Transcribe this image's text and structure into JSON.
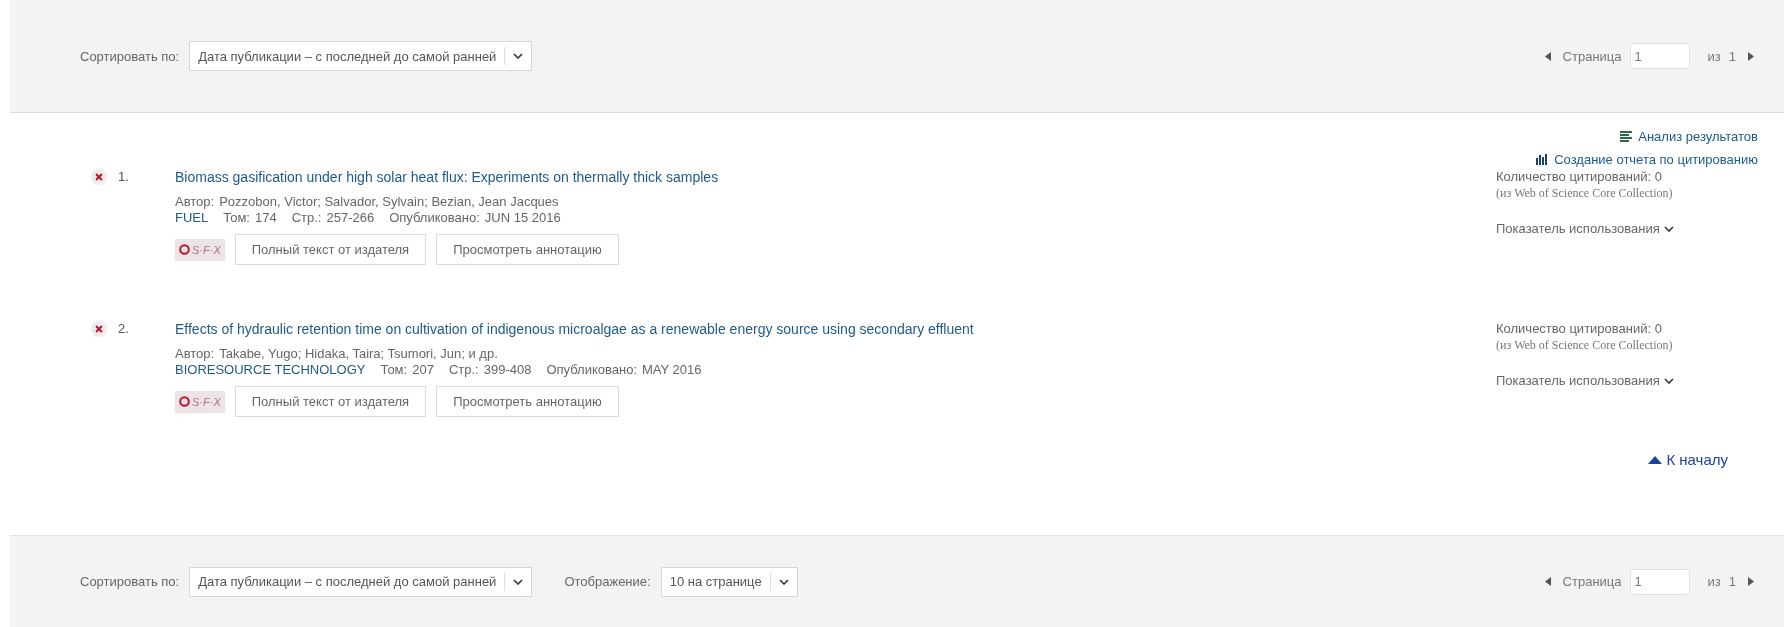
{
  "top_bar": {
    "sort_label": "Сортировать по:",
    "sort_value": "Дата публикации – с последней до самой ранней",
    "pager": {
      "page_label": "Страница",
      "page_value": "1",
      "of_label": "из",
      "total": "1"
    }
  },
  "tools": [
    {
      "kind": "analyze",
      "label": "Анализ результатов"
    },
    {
      "kind": "citation_report",
      "label": "Создание отчета по цитированию"
    }
  ],
  "records": [
    {
      "number": "1.",
      "title": "Biomass gasification under high solar heat flux: Experiments on thermally thick samples",
      "author_label": "Автор:",
      "authors": "Pozzobon, Victor; Salvador, Sylvain; Bezian, Jean Jacques",
      "journal": "FUEL",
      "details": [
        {
          "label": "Том:",
          "value": "174"
        },
        {
          "label": "Стр.:",
          "value": "257-266"
        },
        {
          "label": "Опубликовано:",
          "value": "JUN 15 2016"
        }
      ],
      "sfx": "S·F·X",
      "buttons": [
        "Полный текст от издателя",
        "Просмотреть аннотацию"
      ],
      "citations": "Количество цитирований: 0",
      "citations_source": "(из Web of Science Core Collection)",
      "usage": "Показатель использования"
    },
    {
      "number": "2.",
      "title": "Effects of hydraulic retention time on cultivation of indigenous microalgae as a renewable energy source using secondary effluent",
      "author_label": "Автор:",
      "authors": "Takabe, Yugo; Hidaka, Taira; Tsumori, Jun; и др.",
      "journal": "BIORESOURCE TECHNOLOGY",
      "details": [
        {
          "label": "Том:",
          "value": "207"
        },
        {
          "label": "Стр.:",
          "value": "399-408"
        },
        {
          "label": "Опубликовано:",
          "value": "MAY 2016"
        }
      ],
      "sfx": "S·F·X",
      "buttons": [
        "Полный текст от издателя",
        "Просмотреть аннотацию"
      ],
      "citations": "Количество цитирований: 0",
      "citations_source": "(из Web of Science Core Collection)",
      "usage": "Показатель использования"
    }
  ],
  "back_to_top": "К началу",
  "bottom_bar": {
    "sort_label": "Сортировать по:",
    "sort_value": "Дата публикации – с последней до самой ранней",
    "display_label": "Отображение:",
    "display_value": "10 на странице",
    "pager": {
      "page_label": "Страница",
      "page_value": "1",
      "of_label": "из",
      "total": "1"
    }
  }
}
